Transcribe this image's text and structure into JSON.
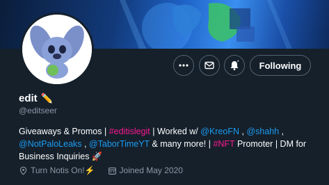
{
  "profile": {
    "name": "edit",
    "name_emoji": "✏️",
    "handle": "@editseer",
    "bio": {
      "part1": "Giveaways & Promos | ",
      "hashtag1": "#editislegit",
      "part2": " | Worked w/ ",
      "mention1": "@KreoFN",
      "sep1": " , ",
      "mention2": "@shahh",
      "sep2": " ,",
      "mention3": "@NotPaloLeaks",
      "sep3": " , ",
      "mention4": "@TaborTimeYT",
      "part3": " & many more! | ",
      "hashtag2": "#NFT",
      "part4": " Promoter | DM for Business Inquiries ",
      "emoji": "🚀"
    },
    "location": "Turn Notis On!⚡",
    "joined": "Joined May 2020"
  },
  "actions": {
    "following_label": "Following"
  },
  "icons": {
    "more": "more-icon",
    "message": "envelope-icon",
    "notifications": "bell-icon",
    "location": "location-pin-icon",
    "calendar": "calendar-icon"
  },
  "colors": {
    "background": "#15202b",
    "link": "#1d9bf0",
    "hashtag": "#f9188f",
    "muted": "#8b98a5",
    "border": "#536471"
  }
}
